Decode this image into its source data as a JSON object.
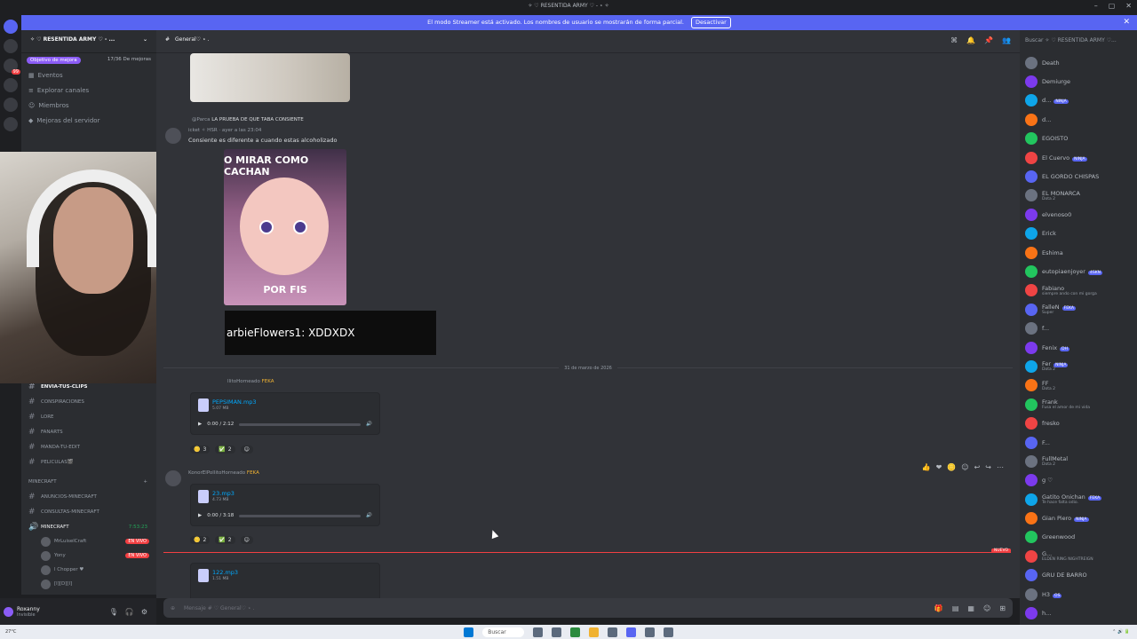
{
  "window": {
    "title": "✧ ♡ RESENTIDA ARMY ♡ - ⋆ ✧"
  },
  "streamer_banner": {
    "text": "El modo Streamer está activado. Los nombres de usuario se mostrarán de forma parcial.",
    "button": "Desactivar"
  },
  "server": {
    "name": "✧ ♡ RESENTIDA ARMY ♡ - ...",
    "boost_label": "Objetivo de mejora",
    "boost_count": "17/36 De mejoras"
  },
  "nav": [
    "Eventos",
    "Explorar canales",
    "Miembros",
    "Mejoras del servidor"
  ],
  "channels": [
    {
      "label": "Envia-tus-Clips",
      "selected": true
    },
    {
      "label": "Conspiraciones"
    },
    {
      "label": "Lore"
    },
    {
      "label": "Fanarts"
    },
    {
      "label": "Manda-tu-edit"
    },
    {
      "label": "Peliculas🎬"
    }
  ],
  "minecraft_category": "MINECRAFT",
  "minecraft_channels": [
    "Anuncios-Minecraft",
    "Consultas-Minecraft"
  ],
  "voice_channel": {
    "label": "MINECRAFT",
    "timer": "7:53:23"
  },
  "voice_users": [
    {
      "name": "MrLuiselCraft",
      "badge": "EN VIVO"
    },
    {
      "name": "Yony",
      "badge": "EN VIVO"
    },
    {
      "name": "l Chopper ♥",
      "badge": ""
    },
    {
      "name": "[l][D][l]",
      "badge": ""
    }
  ],
  "user": {
    "name": "Roxanny",
    "status": "Invisible"
  },
  "chat_header": {
    "channel": "General♡ ⋆ ."
  },
  "search_placeholder": "Buscar ✧ ♡ RESENTIDA ARMY ♡...",
  "messages": {
    "reply_author": "@Parca",
    "reply_text": "LA PRUEBA DE QUE TABA CONSIENTE",
    "reply_meta": "icket ✧ HSR · ayer a las 23:04",
    "text": "Consiente es diferente a cuando estas alcoholizado",
    "sticker_top": "O MIRAR COMO CACHAN",
    "sticker_bottom": "POR FIS",
    "overlay_chat": "arbieFlowers1: XDDXDX",
    "date_separator": "31 de marzo de 2026",
    "author1": "llitoHorneado",
    "author2": "KonorElPollitoHorneado",
    "author_tag": "FEKA",
    "new_label": "NUEVO"
  },
  "attachments": [
    {
      "name": "PEPSIMAN.mp3",
      "size": "5.07 MB",
      "time": "0:00 / 2:12",
      "progress": 0.0
    },
    {
      "name": "23.mp3",
      "size": "4.73 MB",
      "time": "0:00 / 3:18",
      "progress": 0.0
    },
    {
      "name": "122.mp3",
      "size": "1.51 MB",
      "time": "",
      "progress": 0.0
    }
  ],
  "reactions1": [
    {
      "emoji": "🪙",
      "count": "3"
    },
    {
      "emoji": "✅",
      "count": "2"
    }
  ],
  "reactions2": [
    {
      "emoji": "🪙",
      "count": "2"
    },
    {
      "emoji": "✅",
      "count": "2"
    }
  ],
  "composer": {
    "placeholder": "Mensaje # ♡ General♡ ⋆ ."
  },
  "members": [
    {
      "name": "Death",
      "sub": ""
    },
    {
      "name": "Demiurge",
      "sub": ""
    },
    {
      "name": "d...",
      "sub": "",
      "tag": "NINJA"
    },
    {
      "name": "d...",
      "sub": ""
    },
    {
      "name": "EGOISTO",
      "sub": ""
    },
    {
      "name": "El Cuervo",
      "sub": "",
      "tag": "NINJA"
    },
    {
      "name": "EL GORDO CHISPAS",
      "sub": ""
    },
    {
      "name": "EL MONARCA",
      "sub": "Dota 2"
    },
    {
      "name": "elvenoso0",
      "sub": ""
    },
    {
      "name": "Erick",
      "sub": ""
    },
    {
      "name": "Eshima",
      "sub": ""
    },
    {
      "name": "eutopiaenjoyer",
      "sub": "",
      "tag": "4SKN"
    },
    {
      "name": "Fabiano",
      "sub": "siempre ando con mi gorga"
    },
    {
      "name": "FalleN",
      "sub": "Super",
      "tag": "FEKA"
    },
    {
      "name": "f...",
      "sub": ""
    },
    {
      "name": "Fenix",
      "sub": "",
      "tag": "DH"
    },
    {
      "name": "Fer",
      "sub": "Dota 2",
      "tag": "NINJA"
    },
    {
      "name": "FF",
      "sub": "Dota 2"
    },
    {
      "name": "Frank",
      "sub": "Fusa el amor de mi vida"
    },
    {
      "name": "fresko",
      "sub": ""
    },
    {
      "name": "F...",
      "sub": ""
    },
    {
      "name": "FullMetal",
      "sub": "Dota 2"
    },
    {
      "name": "g ♡",
      "sub": ""
    },
    {
      "name": "Gatito Onichan",
      "sub": "Te hace falta odio.",
      "tag": "FEKA"
    },
    {
      "name": "Gian Piero",
      "sub": "",
      "tag": "NINJA"
    },
    {
      "name": "Greenwood",
      "sub": ""
    },
    {
      "name": "G...",
      "sub": "ELDEN RING NIGHTREIGN"
    },
    {
      "name": "GRU DE BARRO",
      "sub": ""
    },
    {
      "name": "H3",
      "sub": "",
      "tag": "OS"
    },
    {
      "name": "h...",
      "sub": ""
    }
  ],
  "taskbar": {
    "search": "Buscar",
    "weather": "27°C",
    "time": ""
  },
  "colors": {
    "accent": "#5865f2",
    "live": "#f23f42",
    "bg": "#313338"
  }
}
